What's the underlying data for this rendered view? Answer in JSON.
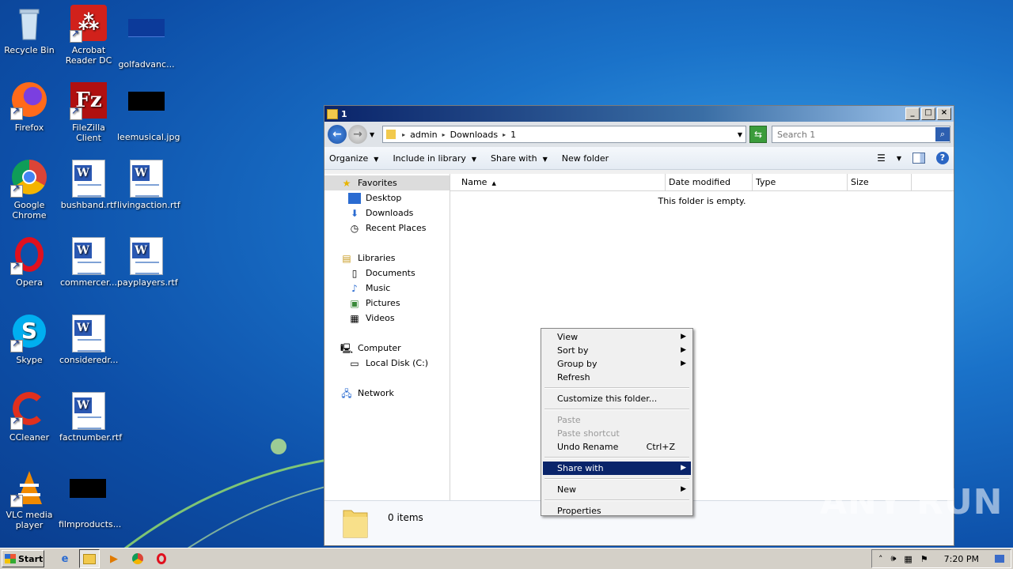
{
  "desktop": {
    "icons": [
      {
        "label": "Recycle Bin"
      },
      {
        "label": "Acrobat Reader DC"
      },
      {
        "label": "golfadvanc..."
      },
      {
        "label": "Firefox"
      },
      {
        "label": "FileZilla Client"
      },
      {
        "label": "leemusical.jpg"
      },
      {
        "label": "Google Chrome"
      },
      {
        "label": "bushband.rtf"
      },
      {
        "label": "livingaction.rtf"
      },
      {
        "label": "Opera"
      },
      {
        "label": "commercer..."
      },
      {
        "label": "payplayers.rtf"
      },
      {
        "label": "Skype"
      },
      {
        "label": "consideredr..."
      },
      {
        "label": "CCleaner"
      },
      {
        "label": "factnumber.rtf"
      },
      {
        "label": "VLC media player"
      },
      {
        "label": "filmproducts..."
      }
    ]
  },
  "window": {
    "title": "1",
    "address": {
      "segments": [
        "admin",
        "Downloads",
        "1"
      ]
    },
    "search": {
      "placeholder": "Search 1"
    },
    "toolbar": {
      "organize": "Organize",
      "include": "Include in library",
      "share": "Share with",
      "newfolder": "New folder"
    },
    "nav": {
      "favorites": "Favorites",
      "desktop": "Desktop",
      "downloads": "Downloads",
      "recent": "Recent Places",
      "libraries": "Libraries",
      "documents": "Documents",
      "music": "Music",
      "pictures": "Pictures",
      "videos": "Videos",
      "computer": "Computer",
      "localdisk": "Local Disk (C:)",
      "network": "Network"
    },
    "columns": {
      "name": "Name",
      "date": "Date modified",
      "type": "Type",
      "size": "Size"
    },
    "empty": "This folder is empty.",
    "status": "0 items"
  },
  "context_menu": {
    "view": "View",
    "sortby": "Sort by",
    "groupby": "Group by",
    "refresh": "Refresh",
    "customize": "Customize this folder...",
    "paste": "Paste",
    "paste_shortcut": "Paste shortcut",
    "undo": "Undo Rename",
    "undo_shortcut": "Ctrl+Z",
    "share": "Share with",
    "new": "New",
    "properties": "Properties"
  },
  "taskbar": {
    "start": "Start",
    "clock": "7:20 PM"
  },
  "watermark": "ANY RUN"
}
